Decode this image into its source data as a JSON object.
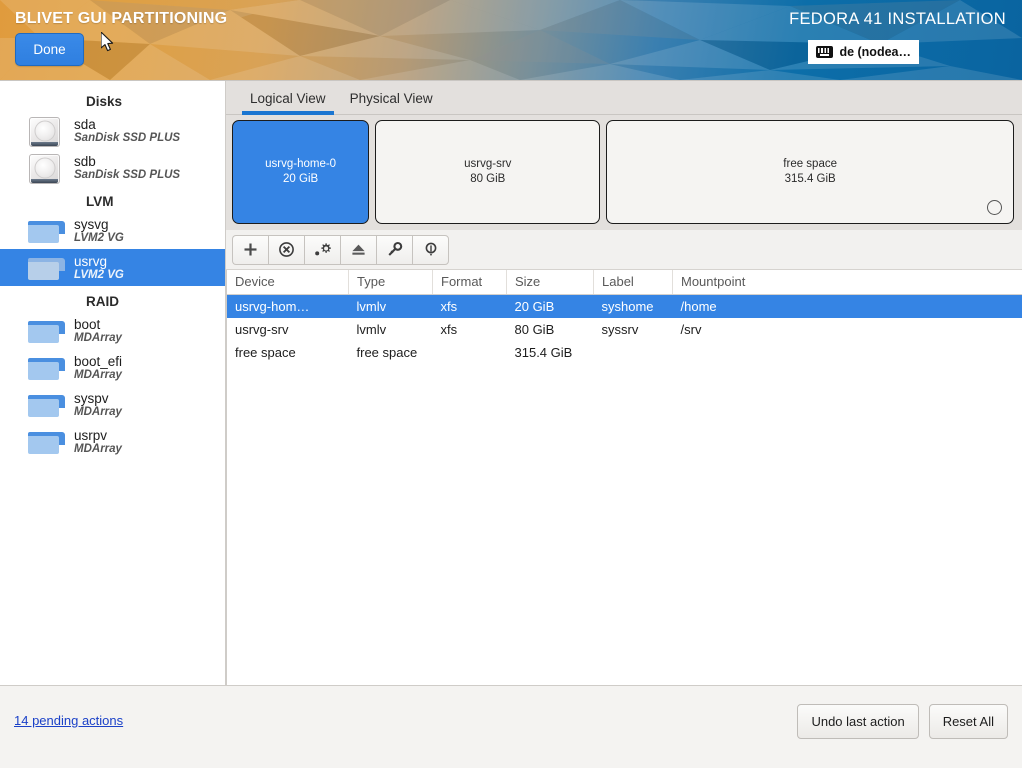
{
  "header": {
    "title": "BLIVET GUI PARTITIONING",
    "done_label": "Done",
    "install_title": "FEDORA 41 INSTALLATION",
    "keyboard_layout": "de (nodea…",
    "keyboard_icon": "keyboard-icon",
    "accent_color": "#3584e4"
  },
  "sidebar": {
    "sections": [
      {
        "title": "Disks",
        "items": [
          {
            "name": "sda",
            "subtitle": "SanDisk SSD PLUS",
            "icon": "disk-icon",
            "selected": false
          },
          {
            "name": "sdb",
            "subtitle": "SanDisk SSD PLUS",
            "icon": "disk-icon",
            "selected": false
          }
        ]
      },
      {
        "title": "LVM",
        "items": [
          {
            "name": "sysvg",
            "subtitle": "LVM2 VG",
            "icon": "folder-icon",
            "selected": false
          },
          {
            "name": "usrvg",
            "subtitle": "LVM2 VG",
            "icon": "folder-icon",
            "selected": true
          }
        ]
      },
      {
        "title": "RAID",
        "items": [
          {
            "name": "boot",
            "subtitle": "MDArray",
            "icon": "folder-icon",
            "selected": false
          },
          {
            "name": "boot_efi",
            "subtitle": "MDArray",
            "icon": "folder-icon",
            "selected": false
          },
          {
            "name": "syspv",
            "subtitle": "MDArray",
            "icon": "folder-icon",
            "selected": false
          },
          {
            "name": "usrpv",
            "subtitle": "MDArray",
            "icon": "folder-icon",
            "selected": false
          }
        ]
      }
    ]
  },
  "tabs": [
    {
      "label": "Logical View",
      "active": true
    },
    {
      "label": "Physical View",
      "active": false
    }
  ],
  "diagram": {
    "partitions": [
      {
        "name": "usrvg-home-0",
        "size": "20 GiB",
        "selected": true,
        "flex": 20,
        "handle": false
      },
      {
        "name": "usrvg-srv",
        "size": "80 GiB",
        "selected": false,
        "flex": 33,
        "handle": false
      },
      {
        "name": "free space",
        "size": "315.4 GiB",
        "selected": false,
        "flex": 60,
        "handle": true
      }
    ]
  },
  "toolbar": {
    "buttons": [
      {
        "name": "add-button",
        "icon": "plus-icon"
      },
      {
        "name": "delete-button",
        "icon": "circle-x-icon"
      },
      {
        "name": "edit-settings-button",
        "icon": "gear-icon"
      },
      {
        "name": "unmount-button",
        "icon": "eject-icon"
      },
      {
        "name": "encryption-button",
        "icon": "key-icon"
      },
      {
        "name": "info-button",
        "icon": "lightbulb-icon"
      }
    ]
  },
  "table": {
    "columns": [
      "Device",
      "Type",
      "Format",
      "Size",
      "Label",
      "Mountpoint"
    ],
    "rows": [
      {
        "device": "usrvg-hom…",
        "type": "lvmlv",
        "format": "xfs",
        "size": "20 GiB",
        "label": "syshome",
        "mountpoint": "/home",
        "selected": true,
        "indent": true
      },
      {
        "device": "usrvg-srv",
        "type": "lvmlv",
        "format": "xfs",
        "size": "80 GiB",
        "label": "syssrv",
        "mountpoint": "/srv",
        "selected": false,
        "indent": false
      },
      {
        "device": "free space",
        "type": "free space",
        "format": "",
        "size": "315.4 GiB",
        "label": "",
        "mountpoint": "",
        "selected": false,
        "indent": false
      }
    ]
  },
  "footer": {
    "pending_actions": "14 pending actions",
    "undo_label": "Undo last action",
    "reset_label": "Reset All"
  }
}
